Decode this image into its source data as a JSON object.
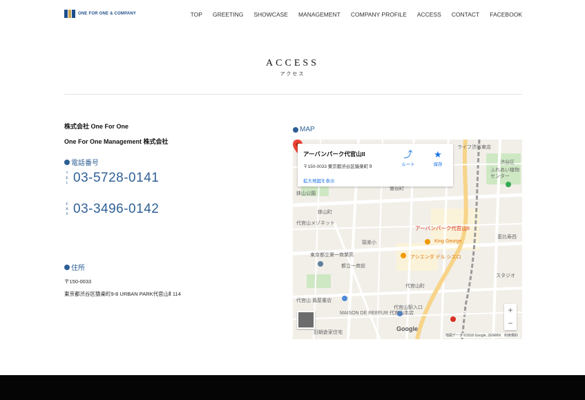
{
  "header": {
    "logo_text": "ONE FOR ONE & COMPANY",
    "nav": [
      "TOP",
      "GREETING",
      "SHOWCASE",
      "MANAGEMENT",
      "COMPANY PROFILE",
      "ACCESS",
      "CONTACT",
      "FACEBOOK"
    ]
  },
  "page": {
    "title_en": "ACCESS",
    "title_ja": "アクセス"
  },
  "company": {
    "name1": "株式会社 One For One",
    "name2": "One For One Management 株式会社"
  },
  "phone": {
    "heading": "電話番号",
    "tel_label": [
      "T",
      "E",
      "L"
    ],
    "tel": "03-5728-0141",
    "fax_label": [
      "F",
      "A",
      "X"
    ],
    "fax": "03-3496-0142"
  },
  "address": {
    "heading": "住所",
    "postal": "〒150-0033",
    "line": "東京都渋谷区猿楽町9-8 URBAN PARK代官山Ⅱ 114"
  },
  "map": {
    "heading": "MAP",
    "card_title": "アーバンパーク代官山II",
    "card_addr": "〒150-0033 東京都渋谷区猿楽町９",
    "card_link": "拡大地図を表示",
    "route_label": "ルート",
    "save_label": "保存",
    "pin_label": "アーバンパーク代官山II",
    "zoom_in": "+",
    "zoom_out": "−",
    "attribution": "地図データ ©2018 Google, ZENRIN　利用規約",
    "google": "Google",
    "labels": {
      "hachiyama_park": "鉢山公園",
      "hachiyama_cho": "鉢山町",
      "daikanyama_maisonette": "代官山メゾネット",
      "sarugaku_elementary": "猿楽小",
      "daiichi_shogyo": "東京都立第一商業高",
      "toritsu_daiichi": "都立一商前",
      "king_george": "King George",
      "ashienda": "アシエンダ デル シエロ",
      "daikanyama_cho": "代官山町",
      "daikanyama_tsutaya": "代官山 蔦屋書店",
      "maison_de_reefur": "MAISON DE REEFUR 代官山本店",
      "kyu_asakura": "旧朝倉家住宅",
      "daikanyama_station": "代官山駅入口",
      "shibuya_ku": "渋谷区",
      "fureai_botanical": "ふれあい植物センター",
      "ebisu": "恵比寿西",
      "sukasuta": "スタジオ",
      "life_shibuya": "ライフ渋谷東店",
      "keisatsu": "鶯谷町"
    }
  }
}
